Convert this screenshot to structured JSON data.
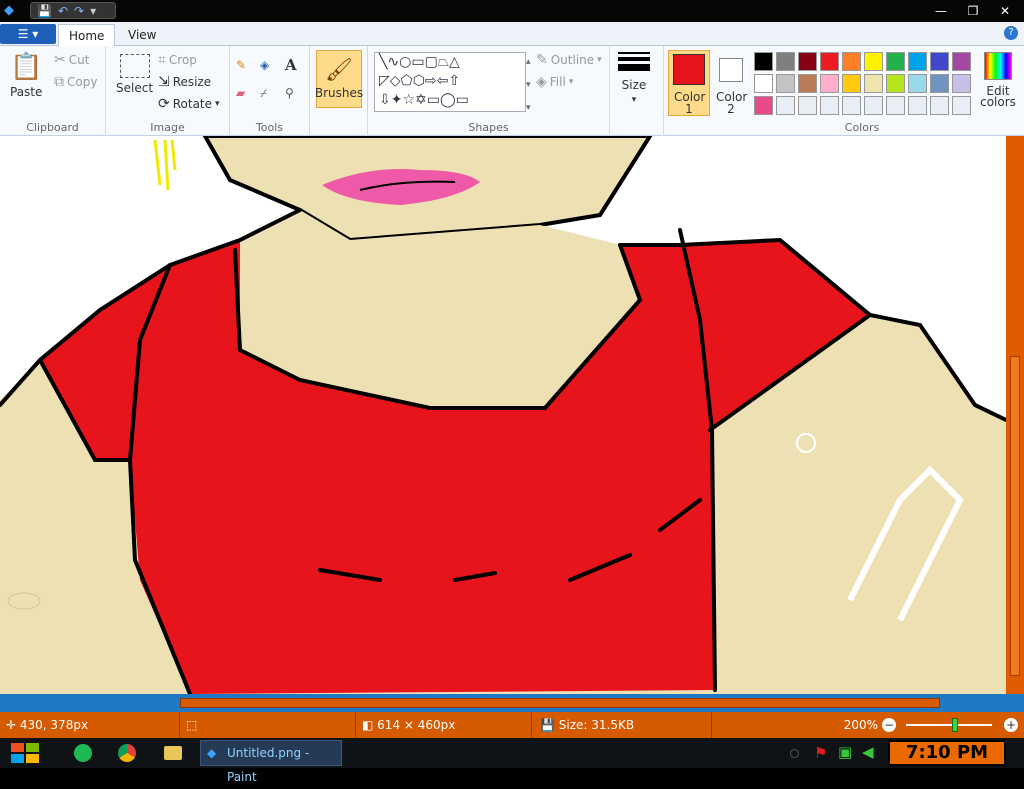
{
  "window": {
    "title": "Untitled.png - Paint",
    "buttons": [
      "minimize",
      "restore",
      "close"
    ]
  },
  "ribbon": {
    "file_label": "☰ ▾",
    "tabs": [
      {
        "label": "Home",
        "active": true
      },
      {
        "label": "View",
        "active": false
      }
    ],
    "clipboard": {
      "paste": "Paste",
      "cut": "Cut",
      "copy": "Copy",
      "group": "Clipboard"
    },
    "image": {
      "select": "Select",
      "crop": "Crop",
      "resize": "Resize",
      "rotate": "Rotate",
      "group": "Image"
    },
    "tools": {
      "group": "Tools"
    },
    "brushes": {
      "label": "Brushes"
    },
    "shapes": {
      "outline": "Outline",
      "fill": "Fill",
      "group": "Shapes"
    },
    "size": {
      "label": "Size"
    },
    "color1": {
      "label": "Color 1",
      "value": "#e8141c"
    },
    "color2": {
      "label": "Color 2",
      "value": "#ffffff"
    },
    "colors": {
      "group": "Colors",
      "edit": "Edit colors"
    },
    "palette": [
      "#000000",
      "#7f7f7f",
      "#880015",
      "#ed1c24",
      "#ff7f27",
      "#fff200",
      "#22b14c",
      "#00a2e8",
      "#3f48cc",
      "#a349a4",
      "#ffffff",
      "#c3c3c3",
      "#b97a57",
      "#ffaec9",
      "#ffc90e",
      "#efe4b0",
      "#b5e61d",
      "#99d9ea",
      "#7092be",
      "#c8bfe7",
      "#e74a88"
    ]
  },
  "status": {
    "cursor": "430, 378px",
    "dimensions": "614 × 460px",
    "size": "Size: 31.5KB",
    "zoom": "200%"
  },
  "taskbar": {
    "task": "Untitled.png - Paint",
    "time": "7:10 PM"
  }
}
